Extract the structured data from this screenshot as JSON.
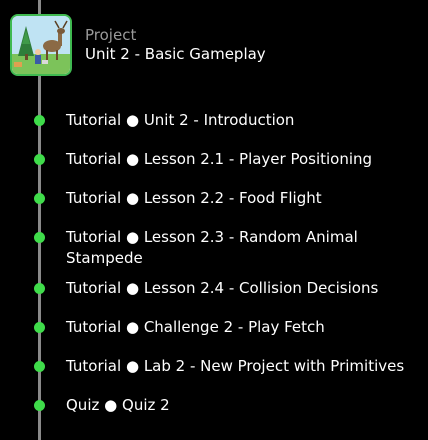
{
  "project": {
    "label": "Project",
    "title": "Unit 2 - Basic Gameplay",
    "thumbnail_icon": "game-scene-thumbnail"
  },
  "colors": {
    "accent": "#3fdc4a",
    "timeline": "#8a8a8a",
    "background": "#000000",
    "muted_text": "#9a9a9a"
  },
  "items": [
    {
      "type": "Tutorial",
      "separator": "●",
      "title": "Unit 2 - Introduction"
    },
    {
      "type": "Tutorial",
      "separator": "●",
      "title": "Lesson 2.1 - Player Positioning"
    },
    {
      "type": "Tutorial",
      "separator": "●",
      "title": "Lesson 2.2 - Food Flight"
    },
    {
      "type": "Tutorial",
      "separator": "●",
      "title": "Lesson 2.3 - Random Animal Stampede"
    },
    {
      "type": "Tutorial",
      "separator": "●",
      "title": "Lesson 2.4 - Collision Decisions"
    },
    {
      "type": "Tutorial",
      "separator": "●",
      "title": "Challenge 2 - Play Fetch"
    },
    {
      "type": "Tutorial",
      "separator": "●",
      "title": "Lab 2 - New Project with Primitives"
    },
    {
      "type": "Quiz",
      "separator": "●",
      "title": "Quiz 2"
    }
  ]
}
